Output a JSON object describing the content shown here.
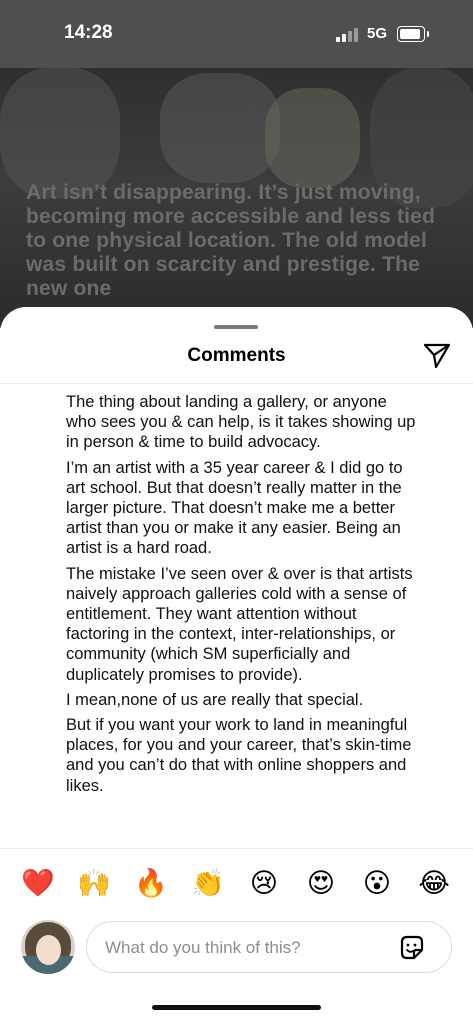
{
  "status_bar": {
    "time": "14:28",
    "network": "5G"
  },
  "post_background": {
    "text": "Art isn’t disappearing. It’s just moving, becoming more accessible and less tied to one physical location. The old model was built on scarcity and prestige. The new one"
  },
  "comments_sheet": {
    "title": "Comments",
    "comment_paragraphs": [
      "The thing about landing a gallery, or anyone who sees you & can help, is it takes showing up in person & time to build advocacy.",
      "I’m an artist with a 35 year career & I did go to art school. But that doesn’t really matter in the larger picture. That doesn’t make me a better artist than you or make it any easier. Being an artist is a hard road.",
      "The mistake I’ve seen over & over is that artists naively approach galleries cold with a sense of entitlement. They want attention without factoring in the context, inter-relationships, or community (which SM superficially and duplicately promises to provide).",
      "I mean,none of us are really that special.",
      "But if you want your work to land in meaningful places, for you and your career, that’s skin-time and you can’t do that with online shoppers and likes."
    ],
    "reactions": [
      {
        "emoji": "❤️",
        "name": "heart"
      },
      {
        "emoji": "🙌",
        "name": "raising-hands"
      },
      {
        "emoji": "🔥",
        "name": "fire"
      },
      {
        "emoji": "👏",
        "name": "clapping-hands"
      },
      {
        "emoji": "😢",
        "name": "crying-face"
      },
      {
        "emoji": "😍",
        "name": "heart-eyes"
      },
      {
        "emoji": "😮",
        "name": "surprised-face"
      },
      {
        "emoji": "😂",
        "name": "tears-of-joy"
      }
    ],
    "input": {
      "placeholder": "What do you think of this?",
      "value": ""
    }
  },
  "colors": {
    "status_bar_bg": "#4f4f4f",
    "sheet_bg": "#ffffff",
    "reaction_heart": "#e0245e"
  }
}
